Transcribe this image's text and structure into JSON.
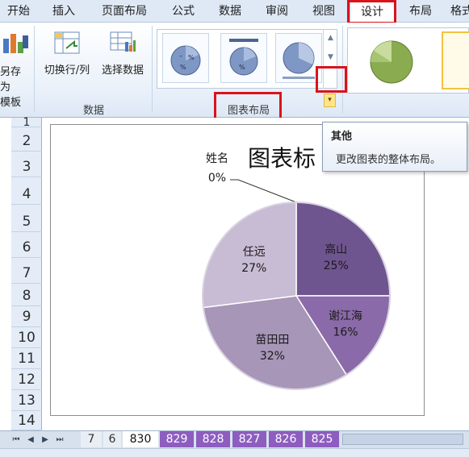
{
  "ribbon_tabs": [
    "开始",
    "插入",
    "页面布局",
    "公式",
    "数据",
    "审阅",
    "视图",
    "设计",
    "布局",
    "格式"
  ],
  "active_tab": "设计",
  "ribbon": {
    "save_template_label_1": "另存为",
    "save_template_label_2": "模板",
    "switch_row_col_label": "切换行/列",
    "select_data_label": "选择数据",
    "data_group_label": "数据",
    "chart_layout_group_label": "图表布局",
    "more_button_glyph": "▾",
    "scroll_up_glyph": "▲",
    "scroll_down_glyph": "▼"
  },
  "tooltip": {
    "title": "其他",
    "description": "更改图表的整体布局。"
  },
  "rows": [
    "1",
    "2",
    "3",
    "4",
    "5",
    "6",
    "7",
    "8",
    "9",
    "10",
    "11",
    "12",
    "13",
    "14"
  ],
  "chart_data": {
    "type": "pie",
    "title": "图表标",
    "categories": [
      "高山",
      "谢江海",
      "苗田田",
      "任远",
      "姓名"
    ],
    "values": [
      25,
      16,
      32,
      27,
      0
    ],
    "labels": [
      "25%",
      "16%",
      "32%",
      "27%",
      "0%"
    ],
    "colors": [
      "#6f558f",
      "#8a6aa8",
      "#a796b8",
      "#c7bcd4",
      "#5a4a70"
    ]
  },
  "sheet_tabs": {
    "plain": [
      "7",
      "6"
    ],
    "current": "830",
    "purple": [
      "829",
      "828",
      "827",
      "826",
      "825"
    ],
    "nav": [
      "⏮",
      "◀",
      "▶",
      "⏭"
    ]
  }
}
